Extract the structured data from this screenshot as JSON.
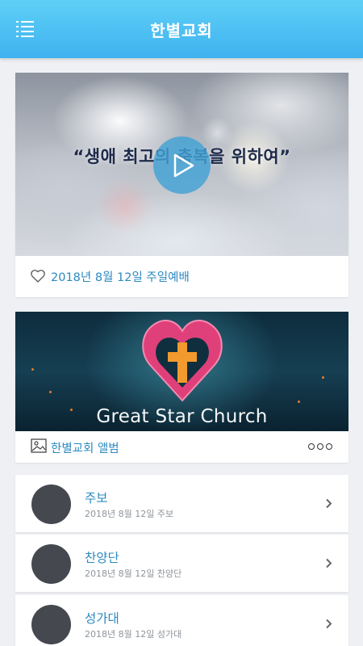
{
  "app": {
    "title": "한별교회",
    "menu_icon": "list-menu-icon",
    "accent_color": "#3fb2ef",
    "link_color": "#2d8ac0"
  },
  "video": {
    "headline": "“생애 최고의 축복을 위하여”",
    "caption": "2018년 8월 12일 주일예배",
    "caption_icon": "heart-outline-icon",
    "play_icon": "play-icon"
  },
  "album": {
    "brand_text": "Great Star Church",
    "caption": "한별교회 앨범",
    "caption_icon": "image-icon",
    "more_icon": "more-horizontal-icon"
  },
  "list": [
    {
      "title": "주보",
      "subtitle": "2018년 8월 12일 주보"
    },
    {
      "title": "찬양단",
      "subtitle": "2018년 8월 12일 찬양단"
    },
    {
      "title": "성가대",
      "subtitle": "2018년 8월 12일 성가대"
    }
  ]
}
